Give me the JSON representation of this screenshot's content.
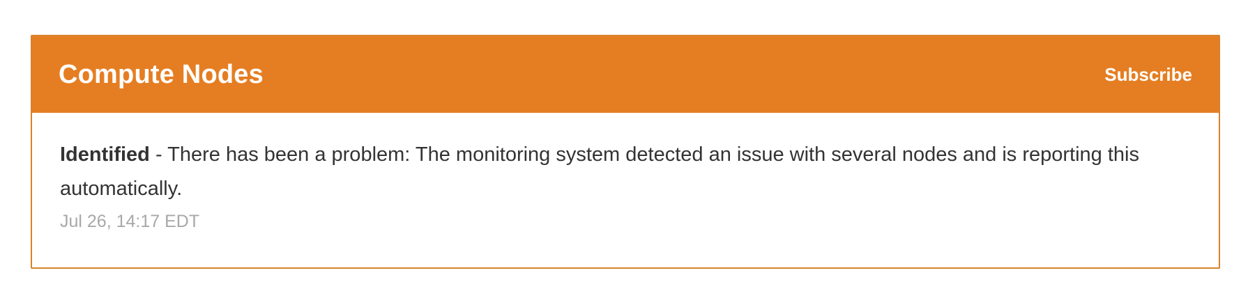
{
  "component": {
    "title": "Compute Nodes",
    "subscribe_label": "Subscribe",
    "accent_color": "#e57e22"
  },
  "update": {
    "status": "Identified",
    "separator": " - ",
    "message": "There has been a problem: The monitoring system detected an issue with several nodes and is reporting this automatically.",
    "timestamp": "Jul 26, 14:17 EDT"
  }
}
